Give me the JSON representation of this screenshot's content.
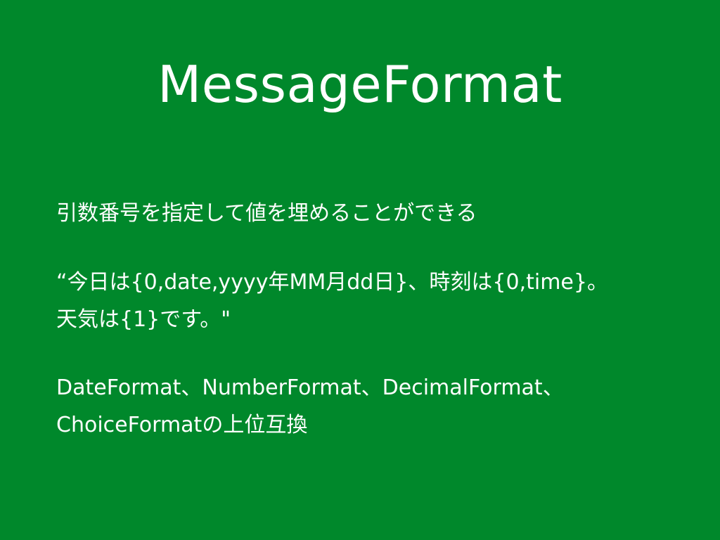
{
  "slide": {
    "title": "MessageFormat",
    "lines": [
      "引数番号を指定して値を埋めることができる",
      "“今日は{0,date,yyyy年MM月dd日}、時刻は{0,time}。",
      "天気は{1}です。\"",
      "DateFormat、NumberFormat、DecimalFormat、",
      "ChoiceFormatの上位互換"
    ]
  },
  "colors": {
    "background": "#00882b",
    "text": "#ffffff"
  }
}
